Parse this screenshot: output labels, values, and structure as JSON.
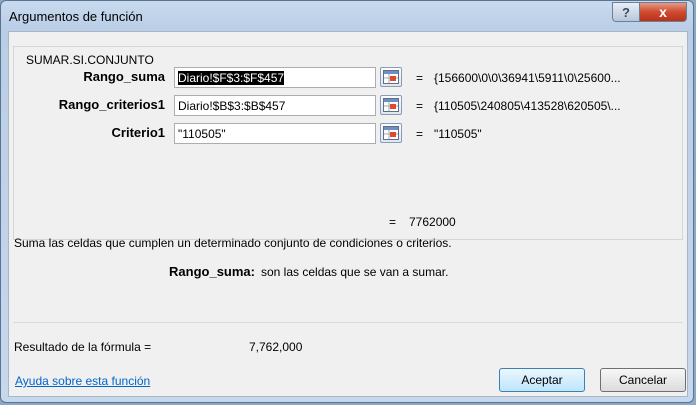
{
  "window": {
    "title": "Argumentos de función",
    "help_glyph": "?",
    "close_glyph": "x"
  },
  "function_name": "SUMAR.SI.CONJUNTO",
  "arguments": [
    {
      "label": "Rango_suma",
      "value": "Diario!$F$3:$F$457",
      "eq": "=",
      "result": "{156600\\0\\0\\36941\\5911\\0\\25600..."
    },
    {
      "label": "Rango_criterios1",
      "value": "Diario!$B$3:$B$457",
      "eq": "=",
      "result": "{110505\\240805\\413528\\620505\\..."
    },
    {
      "label": "Criterio1",
      "value": "\"110505\"",
      "eq": "=",
      "result": "\"110505\""
    }
  ],
  "function_result": {
    "eq": "=",
    "value": "7762000"
  },
  "description": "Suma las celdas que cumplen un determinado conjunto de condiciones o criterios.",
  "arg_description": {
    "name": "Rango_suma:",
    "text": "son las celdas que se van a sumar."
  },
  "formula_result": {
    "label": "Resultado de la fórmula =",
    "value": "7,762,000"
  },
  "help_link": "Ayuda sobre esta función",
  "buttons": {
    "ok": "Aceptar",
    "cancel": "Cancelar"
  },
  "colors": {
    "accent": "#0066cc",
    "close": "#cf4a2e"
  }
}
